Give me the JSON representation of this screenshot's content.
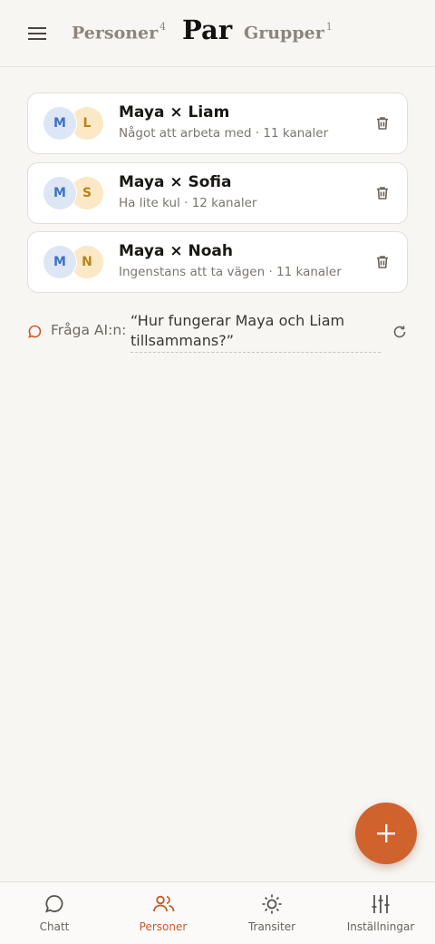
{
  "header": {
    "tabs": [
      {
        "label": "Personer",
        "count": "4"
      },
      {
        "label": "Par"
      },
      {
        "label": "Grupper",
        "count": "1"
      }
    ]
  },
  "pairs": [
    {
      "a_initial": "M",
      "b_initial": "L",
      "title": "Maya × Liam",
      "subtitle": "Något att arbeta med · 11 kanaler"
    },
    {
      "a_initial": "M",
      "b_initial": "S",
      "title": "Maya × Sofia",
      "subtitle": "Ha lite kul · 12 kanaler"
    },
    {
      "a_initial": "M",
      "b_initial": "N",
      "title": "Maya × Noah",
      "subtitle": "Ingenstans att ta vägen · 11 kanaler"
    }
  ],
  "ask": {
    "label": "Fråga AI:n:",
    "value": "“Hur fungerar Maya och Liam tillsammans?”"
  },
  "bottom_nav": [
    {
      "label": "Chatt",
      "icon": "chat-bubble-icon"
    },
    {
      "label": "Personer",
      "icon": "people-icon",
      "active": true
    },
    {
      "label": "Transiter",
      "icon": "sun-icon"
    },
    {
      "label": "Inställningar",
      "icon": "sliders-icon"
    }
  ],
  "colors": {
    "accent": "#d0622e",
    "background": "#f8f6f2",
    "avatar_a_bg": "#dde6f5",
    "avatar_b_bg": "#fbe8c6"
  }
}
